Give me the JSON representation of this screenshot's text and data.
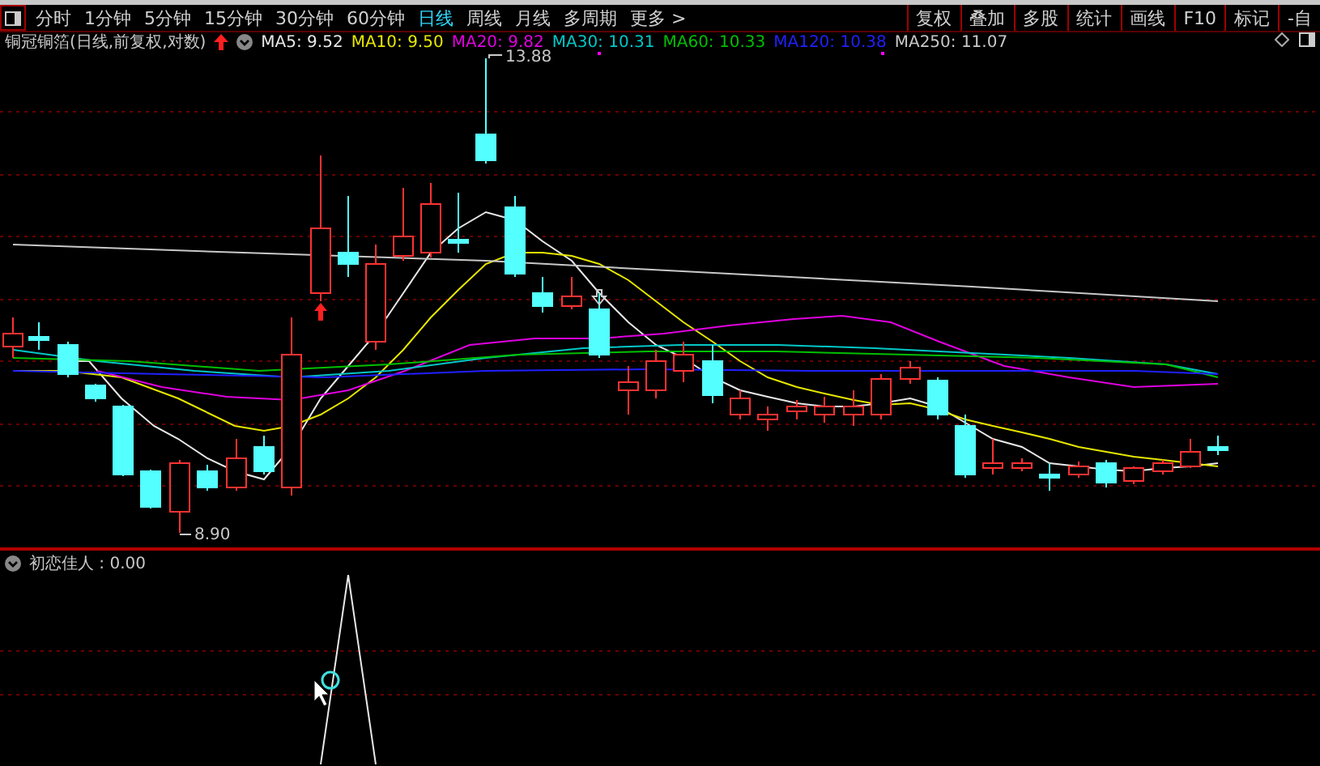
{
  "toolbar": {
    "periods": [
      {
        "label": "分时",
        "selected": false
      },
      {
        "label": "1分钟",
        "selected": false
      },
      {
        "label": "5分钟",
        "selected": false
      },
      {
        "label": "15分钟",
        "selected": false
      },
      {
        "label": "30分钟",
        "selected": false
      },
      {
        "label": "60分钟",
        "selected": false
      },
      {
        "label": "日线",
        "selected": true
      },
      {
        "label": "周线",
        "selected": false
      },
      {
        "label": "月线",
        "selected": false
      },
      {
        "label": "多周期",
        "selected": false
      },
      {
        "label": "更多 >",
        "selected": false
      }
    ],
    "buttons": [
      "复权",
      "叠加",
      "多股",
      "统计",
      "画线",
      "F10",
      "标记",
      "-自"
    ]
  },
  "main_chart": {
    "title": "铜冠铜箔(日线,前复权,对数)",
    "moving_averages": [
      {
        "label": "MA5: 9.52",
        "color": "#e8e8e8"
      },
      {
        "label": "MA10: 9.50",
        "color": "#e6e600"
      },
      {
        "label": "MA20: 9.82",
        "color": "#e000e0"
      },
      {
        "label": "MA30: 10.31",
        "color": "#00c8c8"
      },
      {
        "label": "MA60: 10.33",
        "color": "#00c000"
      },
      {
        "label": "MA120: 10.38",
        "color": "#2020ff"
      },
      {
        "label": "MA250: 11.07",
        "color": "#c8c8c8"
      }
    ],
    "high_label": "13.88",
    "low_label": "8.90"
  },
  "indicator": {
    "legend": "初恋佳人 : 0.00"
  }
}
